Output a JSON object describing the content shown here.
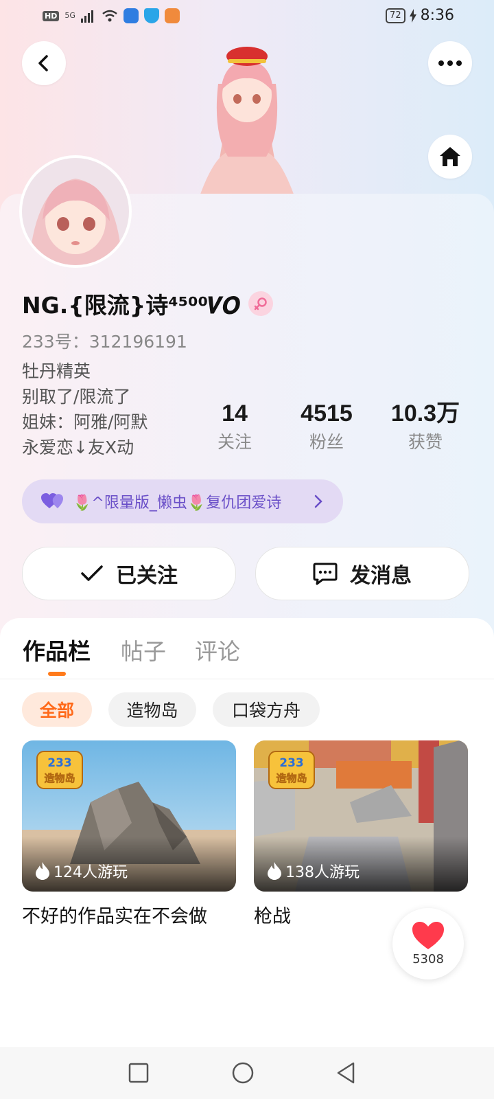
{
  "status_bar": {
    "net_badge": "HD",
    "signal_text": "5G",
    "battery": "72",
    "time": "8:36"
  },
  "profile": {
    "stats": [
      {
        "value": "14",
        "label": "关注"
      },
      {
        "value": "4515",
        "label": "粉丝"
      },
      {
        "value": "10.3万",
        "label": "获赞"
      }
    ],
    "username": "NG.{限流}诗⁴⁵⁰⁰𝑽𝑶",
    "uid": "233号：312196191",
    "bio": [
      "牡丹精英",
      "别取了/限流了",
      "姐妹：阿雅/阿默",
      "永爱恋↓友X动"
    ],
    "guild": "🌷^限量版_懒虫🌷复仇团爱诗",
    "follow_label": "已关注",
    "message_label": "发消息"
  },
  "works": {
    "tabs": [
      "作品栏",
      "帖子",
      "评论"
    ],
    "active_tab": 0,
    "filters": [
      "全部",
      "造物岛",
      "口袋方舟"
    ],
    "active_filter": 0,
    "items": [
      {
        "title": "不好的作品实在不会做",
        "plays": "124人游玩",
        "badge_line1": "233",
        "badge_line2": "造物岛"
      },
      {
        "title": "枪战",
        "plays": "138人游玩",
        "badge_line1": "233",
        "badge_line2": "造物岛"
      }
    ]
  },
  "like_fab": {
    "count": "5308"
  },
  "colors": {
    "accent_orange": "#ff7a1a",
    "guild_purple": "#6a4fc8",
    "like_red": "#ff3a4c"
  },
  "icons": [
    "back-icon",
    "more-icon",
    "home-icon",
    "female-icon",
    "heart-icon",
    "chevron-right-icon",
    "check-icon",
    "chat-icon",
    "flame-icon",
    "square-icon",
    "circle-icon",
    "triangle-back-icon"
  ]
}
